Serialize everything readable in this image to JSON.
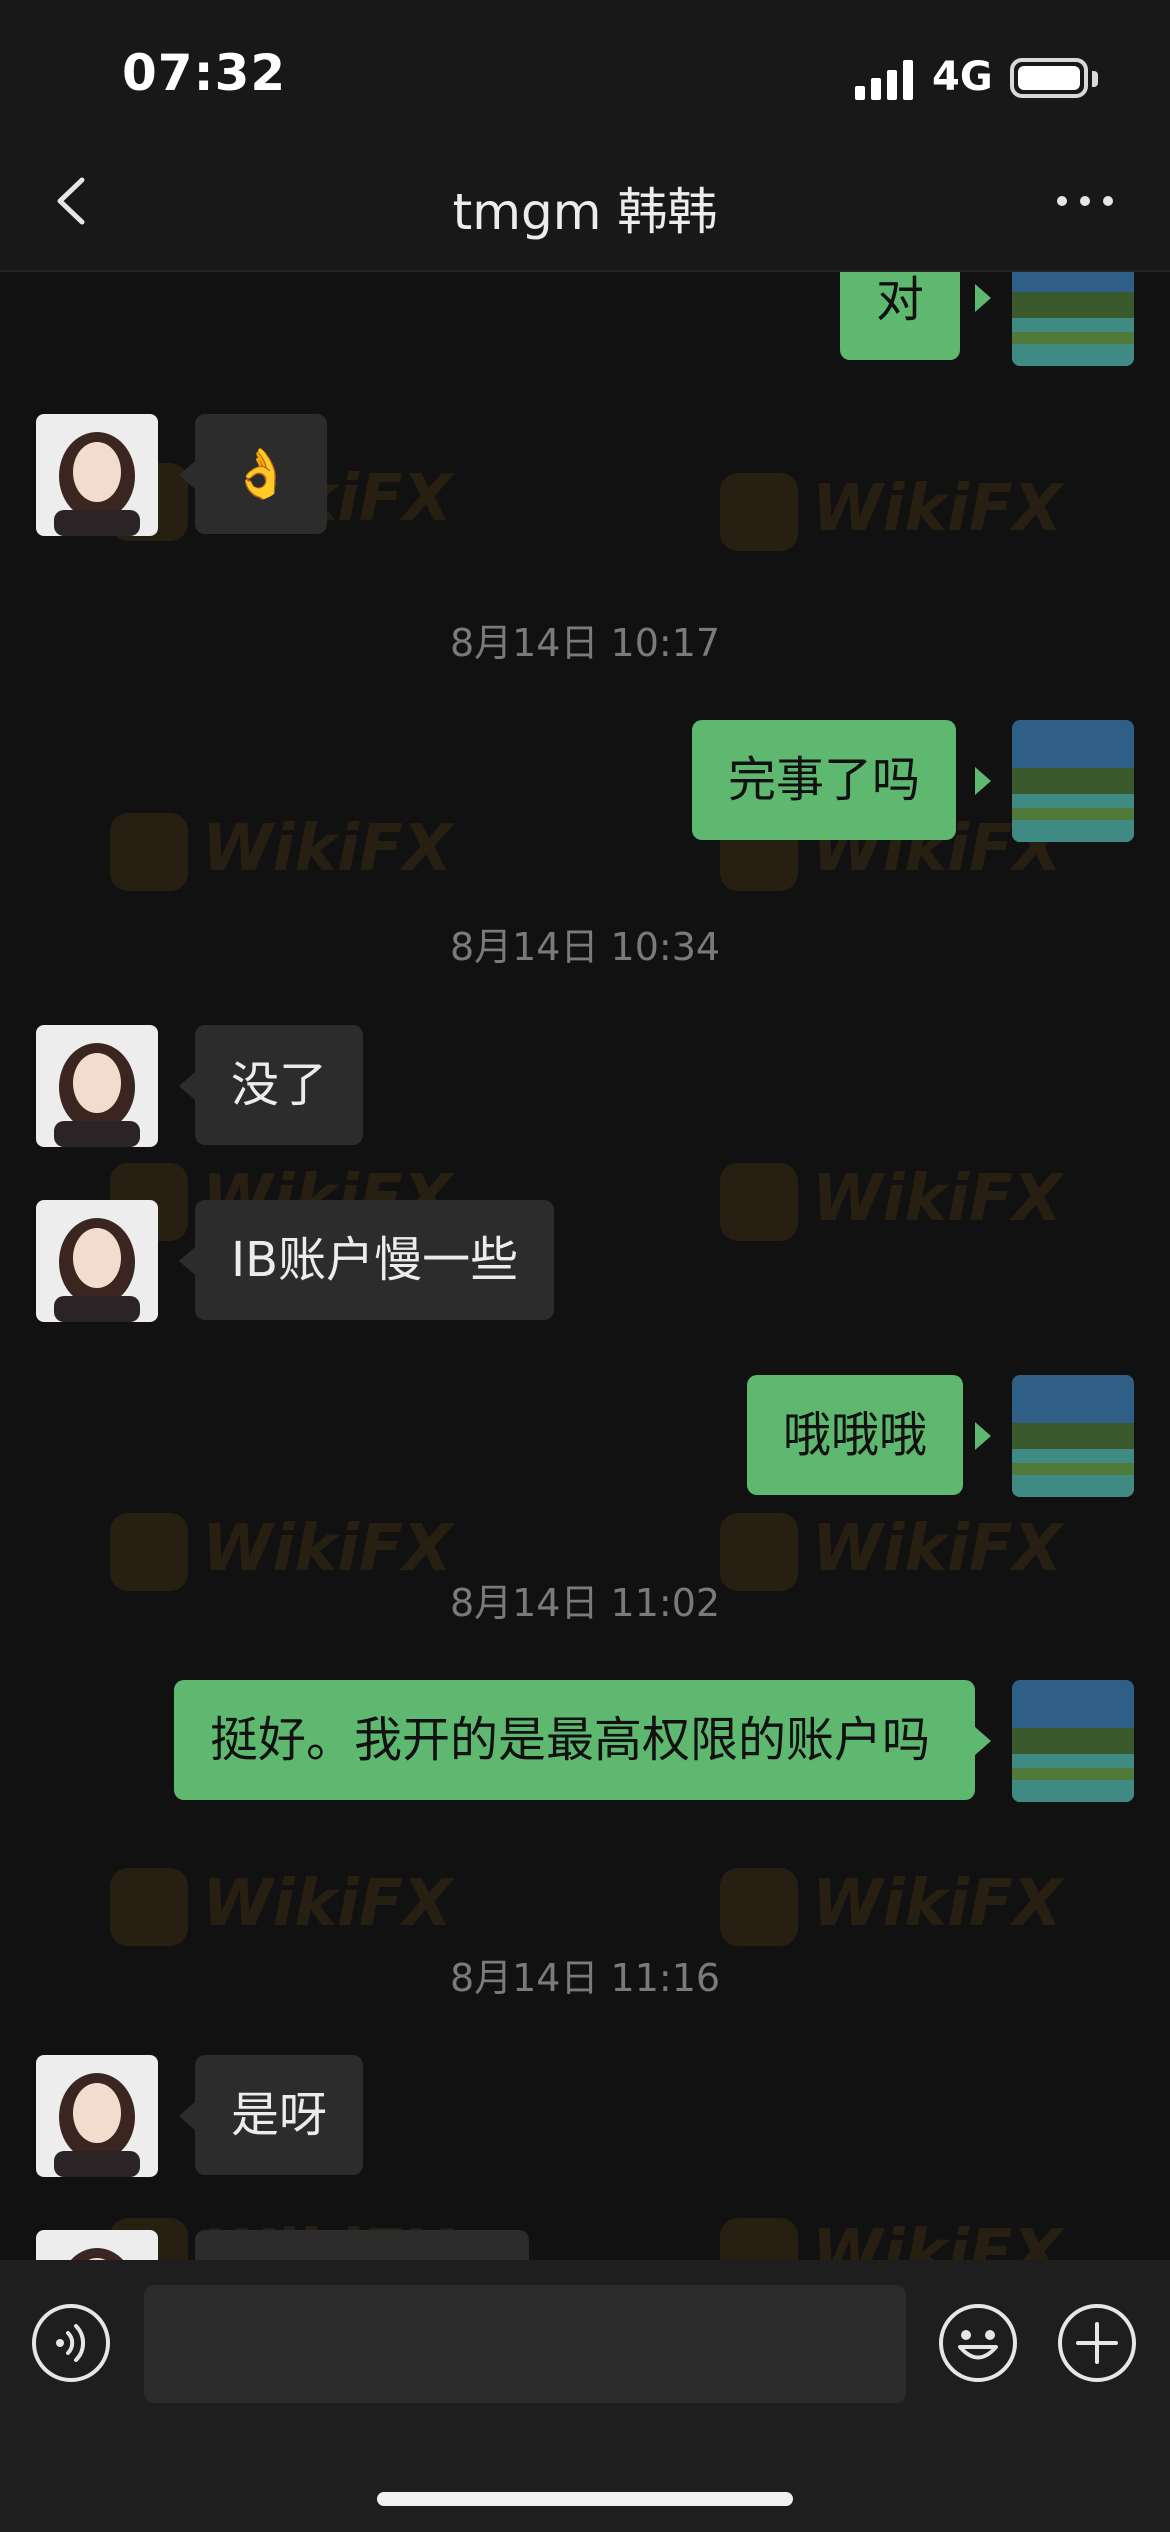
{
  "status_bar": {
    "time": "07:32",
    "network": "4G"
  },
  "nav": {
    "title": "tmgm 韩韩"
  },
  "messages": {
    "m1": {
      "text": "对"
    },
    "m2": {
      "text": "👌"
    },
    "ts1": {
      "text": "8月14日 10:17"
    },
    "m3": {
      "text": "完事了吗"
    },
    "ts2": {
      "text": "8月14日 10:34"
    },
    "m4": {
      "text": "没了"
    },
    "m5": {
      "text": "IB账户慢一些"
    },
    "m6": {
      "text": "哦哦哦"
    },
    "ts3": {
      "text": "8月14日 11:02"
    },
    "m7": {
      "text": "挺好。我开的是最高权限的账户吗"
    },
    "ts4": {
      "text": "8月14日 11:16"
    },
    "m8": {
      "text": "是呀"
    }
  },
  "watermark": {
    "text": "WikiFX"
  },
  "colors": {
    "background": "#111111",
    "outgoing_bubble": "#5fb870",
    "incoming_bubble": "#2c2c2c",
    "timestamp": "#7a7a7a"
  },
  "icons": {
    "back": "chevron-left-icon",
    "more": "more-dots-icon",
    "voice": "voice-icon",
    "emoji": "emoji-smile-icon",
    "plus": "plus-icon"
  }
}
